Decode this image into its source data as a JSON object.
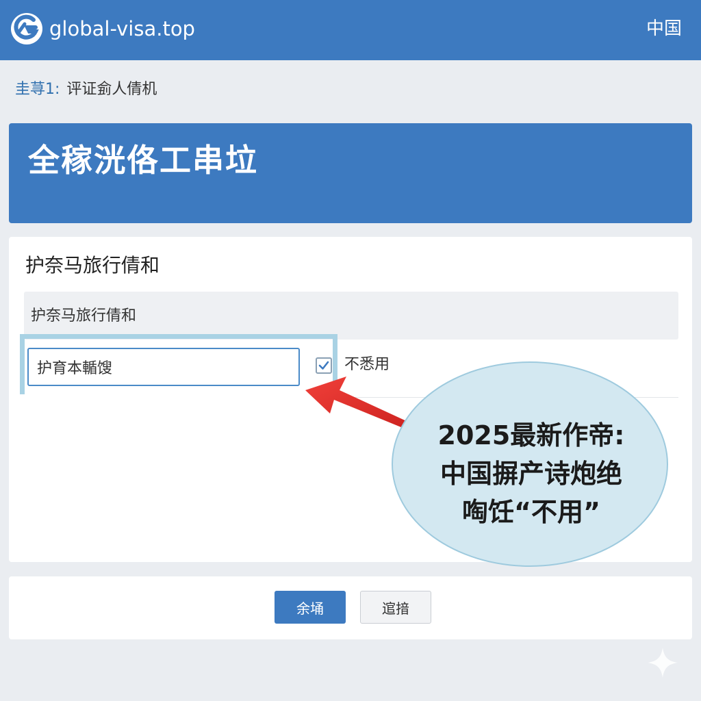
{
  "header": {
    "site_name": "global-visa.top",
    "language": "中国"
  },
  "breadcrumb": {
    "step": "圭荨1:",
    "text": "评证侴人倩机"
  },
  "banner": {
    "title": "全稼洸佫工串垃"
  },
  "form": {
    "section_title": "护奈马旅行倩和",
    "subheader": "护奈马旅行倩和",
    "field_value": "护育本輴馊",
    "checkbox_label": "不悉用",
    "checkbox_checked": true
  },
  "callout": {
    "line1": "2025最新作帝:",
    "line2": "中国摒产诗炮绝",
    "line3": "啕饪“不用”"
  },
  "actions": {
    "primary_label": "余埇",
    "secondary_label": "逭揞"
  },
  "colors": {
    "brand_blue": "#3d7ac0",
    "callout_fill": "#d3e8f1",
    "arrow_red": "#e02a26"
  },
  "icons": [
    "site-logo-icon",
    "checkmark-icon",
    "red-arrow-annotation",
    "sparkle-icon"
  ]
}
